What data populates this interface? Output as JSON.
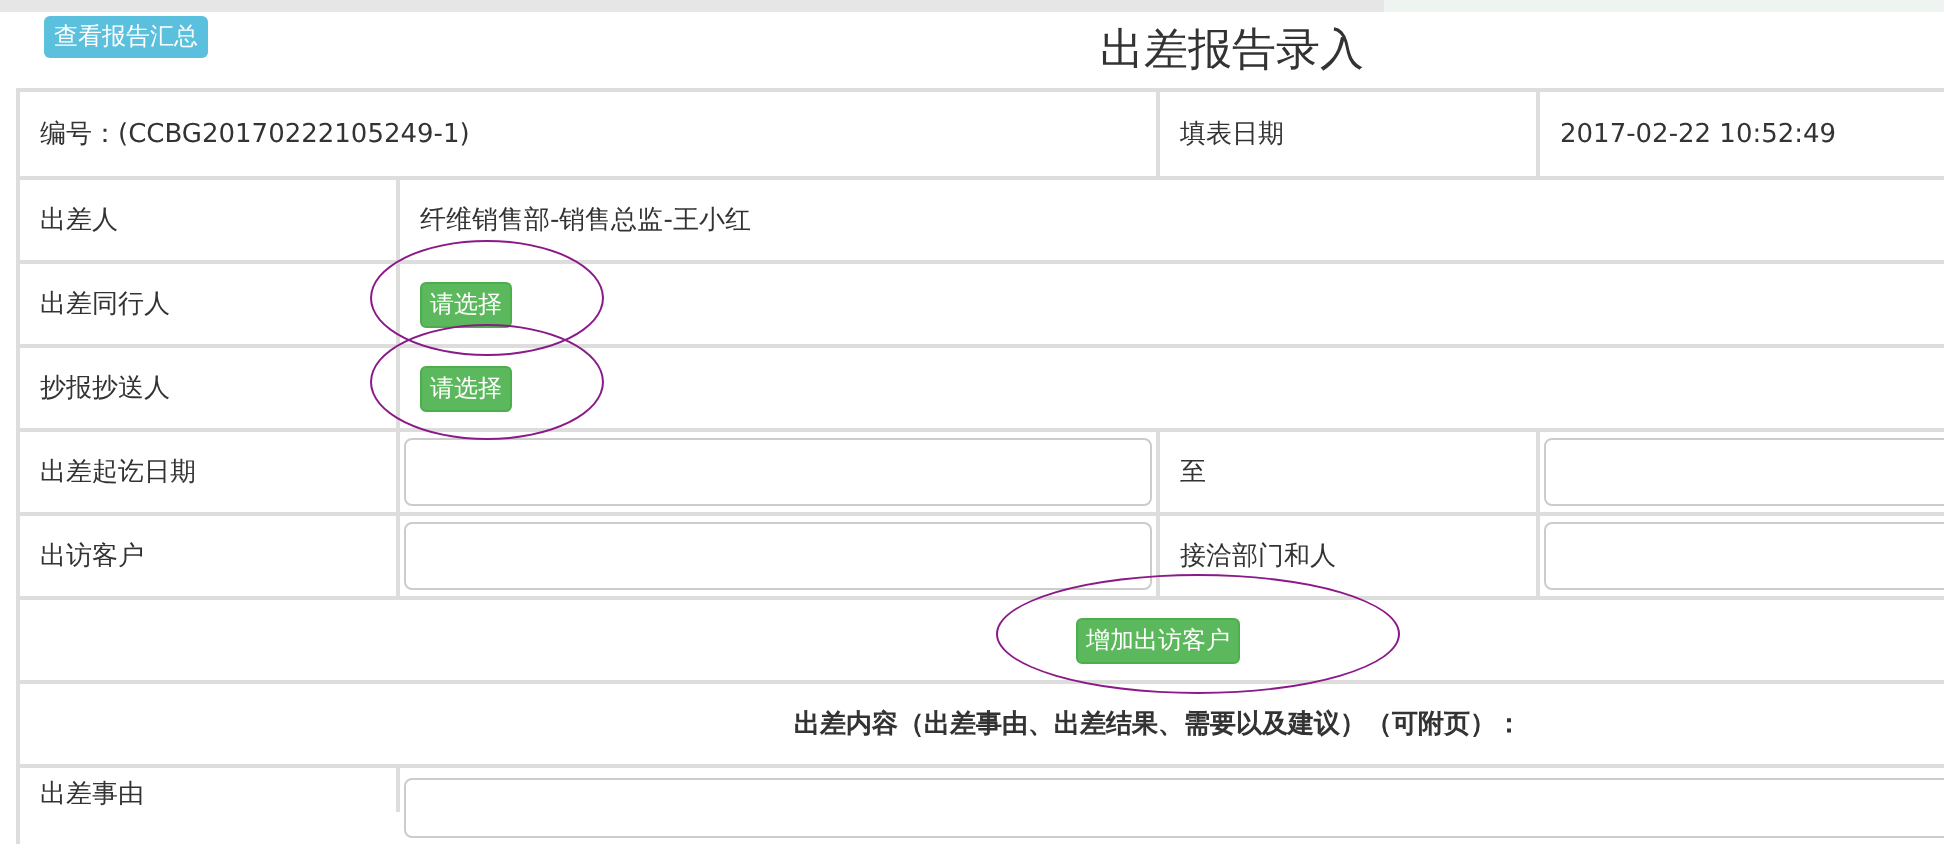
{
  "summary_button": "查看报告汇总",
  "title": "出差报告录入",
  "header_row": {
    "number": "编号：(CCBG20170222105249-1)",
    "date_label": "填表日期",
    "date_value": "2017-02-22 10:52:49"
  },
  "rows": [
    {
      "kind": "text",
      "label": "出差人",
      "value": "纤维销售部-销售总监-王小红"
    },
    {
      "kind": "select",
      "label": "出差同行人",
      "button": "请选择",
      "annotated": true
    },
    {
      "kind": "select",
      "label": "抄报抄送人",
      "button": "请选择",
      "annotated": true
    },
    {
      "kind": "fields",
      "label": "出差起讫日期",
      "label_2": "至"
    },
    {
      "kind": "fields",
      "label": "出访客户",
      "label_2": "接洽部门和人"
    },
    {
      "kind": "add",
      "button": "增加出访客户",
      "annotated": true
    },
    {
      "kind": "heading",
      "text": "出差内容（出差事由、出差结果、需要以及建议）（可附页）："
    },
    {
      "kind": "textarea",
      "label": "出差事由"
    }
  ]
}
